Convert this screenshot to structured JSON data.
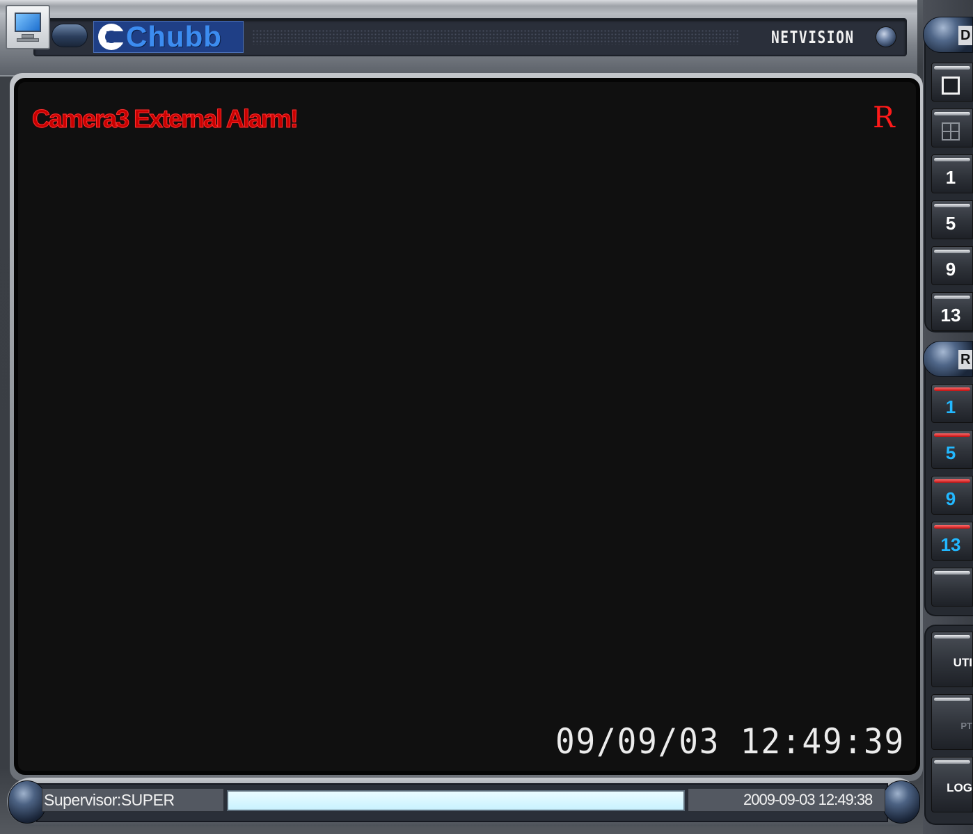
{
  "titlebar": {
    "brand": "Chubb",
    "product": "NETVISION"
  },
  "video": {
    "alarm_message": "Camera3 External Alarm!",
    "record_indicator": "R",
    "osd_timestamp": "09/09/03 12:49:39"
  },
  "statusbar": {
    "user": "Supervisor:SUPER",
    "progress_fraction": 1.0,
    "datetime": "2009-09-03 12:49:38"
  },
  "right_panel": {
    "display_group_label": "D",
    "display_buttons": [
      {
        "icon": "single-view-icon"
      },
      {
        "icon": "quad-view-icon"
      },
      {
        "label": "1"
      },
      {
        "label": "5"
      },
      {
        "label": "9"
      },
      {
        "label": "13"
      }
    ],
    "record_group_label": "R",
    "record_buttons": [
      {
        "label": "1"
      },
      {
        "label": "5"
      },
      {
        "label": "9"
      },
      {
        "label": "13"
      },
      {
        "label": ""
      }
    ],
    "utility_label": "UTI",
    "ptz_label": "PT",
    "log_label": "LOG"
  },
  "colors": {
    "alarm_red": "#c80000",
    "record_channel_blue": "#22b8ff",
    "progress_fill": "#c9f2ff"
  }
}
